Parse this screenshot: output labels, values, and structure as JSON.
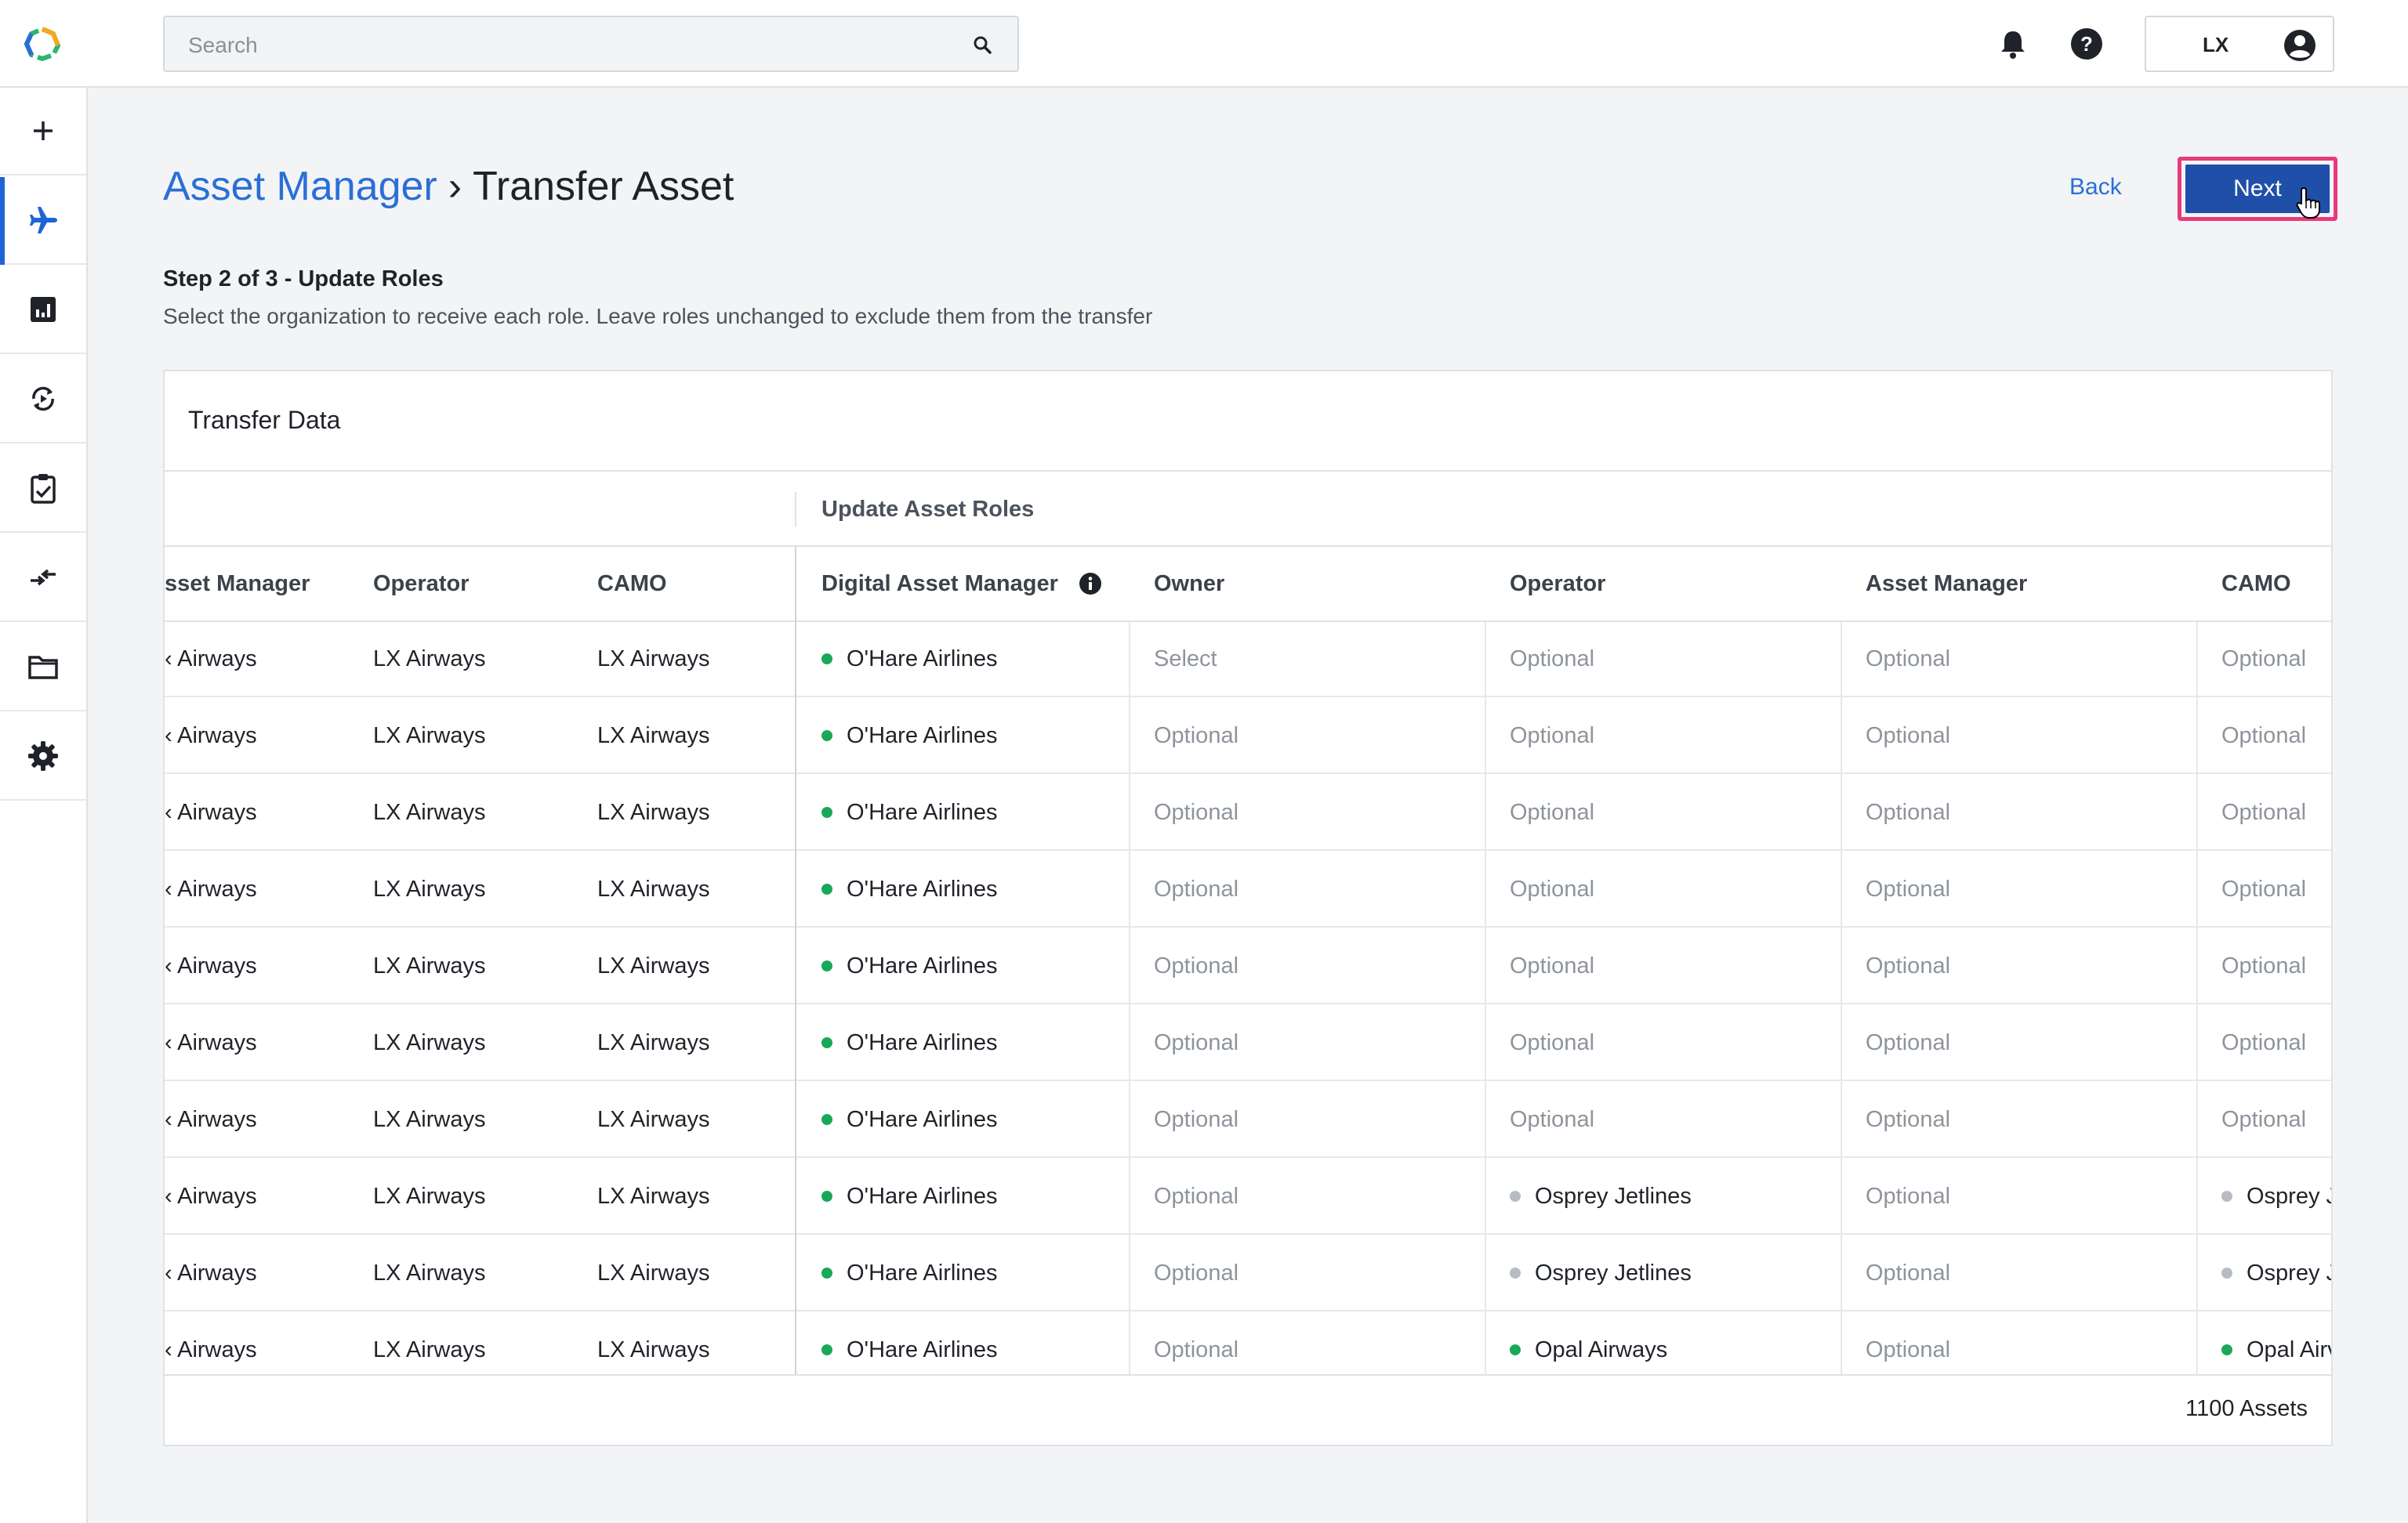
{
  "search": {
    "placeholder": "Search"
  },
  "user": {
    "initials": "LX"
  },
  "colors": {
    "accent": "#1f4fa8",
    "link": "#2a6fd6",
    "highlight": "#e83a7c",
    "status_green": "#18a858",
    "status_grey": "#b7bcc3"
  },
  "sidebar": {
    "items": [
      {
        "icon": "plus-icon"
      },
      {
        "icon": "airplane-icon",
        "active": true
      },
      {
        "icon": "chart-icon"
      },
      {
        "icon": "sync-icon"
      },
      {
        "icon": "clipboard-check-icon"
      },
      {
        "icon": "transfer-icon"
      },
      {
        "icon": "folder-icon"
      },
      {
        "icon": "gear-icon"
      }
    ]
  },
  "breadcrumb": {
    "parent": "Asset Manager",
    "separator": "›",
    "current": "Transfer Asset"
  },
  "actions": {
    "back": "Back",
    "next": "Next"
  },
  "step": {
    "title": "Step 2 of 3 - Update Roles",
    "description": "Select the organization to receive each role. Leave roles unchanged to exclude them from the transfer"
  },
  "card": {
    "title": "Transfer Data",
    "group_label": "Update Asset Roles",
    "footer": "1100 Assets"
  },
  "table": {
    "columns": [
      "sset Manager",
      "Operator",
      "CAMO",
      "Digital Asset Manager",
      "Owner",
      "Operator",
      "Asset Manager",
      "CAMO"
    ],
    "rows": [
      {
        "asset_manager": "‹ Airways",
        "operator": "LX Airways",
        "camo": "LX Airways",
        "dam": "O'Hare Airlines",
        "owner": "Select",
        "new_operator": "Optional",
        "new_asset_manager": "Optional",
        "new_camo": "Optional"
      },
      {
        "asset_manager": "‹ Airways",
        "operator": "LX Airways",
        "camo": "LX Airways",
        "dam": "O'Hare Airlines",
        "owner": "Optional",
        "new_operator": "Optional",
        "new_asset_manager": "Optional",
        "new_camo": "Optional"
      },
      {
        "asset_manager": "‹ Airways",
        "operator": "LX Airways",
        "camo": "LX Airways",
        "dam": "O'Hare Airlines",
        "owner": "Optional",
        "new_operator": "Optional",
        "new_asset_manager": "Optional",
        "new_camo": "Optional"
      },
      {
        "asset_manager": "‹ Airways",
        "operator": "LX Airways",
        "camo": "LX Airways",
        "dam": "O'Hare Airlines",
        "owner": "Optional",
        "new_operator": "Optional",
        "new_asset_manager": "Optional",
        "new_camo": "Optional"
      },
      {
        "asset_manager": "‹ Airways",
        "operator": "LX Airways",
        "camo": "LX Airways",
        "dam": "O'Hare Airlines",
        "owner": "Optional",
        "new_operator": "Optional",
        "new_asset_manager": "Optional",
        "new_camo": "Optional"
      },
      {
        "asset_manager": "‹ Airways",
        "operator": "LX Airways",
        "camo": "LX Airways",
        "dam": "O'Hare Airlines",
        "owner": "Optional",
        "new_operator": "Optional",
        "new_asset_manager": "Optional",
        "new_camo": "Optional"
      },
      {
        "asset_manager": "‹ Airways",
        "operator": "LX Airways",
        "camo": "LX Airways",
        "dam": "O'Hare Airlines",
        "owner": "Optional",
        "new_operator": "Optional",
        "new_asset_manager": "Optional",
        "new_camo": "Optional"
      },
      {
        "asset_manager": "‹ Airways",
        "operator": "LX Airways",
        "camo": "LX Airways",
        "dam": "O'Hare Airlines",
        "owner": "Optional",
        "new_operator": "Osprey Jetlines",
        "new_operator_status": "grey",
        "new_asset_manager": "Optional",
        "new_camo": "Osprey J",
        "new_camo_status": "grey"
      },
      {
        "asset_manager": "‹ Airways",
        "operator": "LX Airways",
        "camo": "LX Airways",
        "dam": "O'Hare Airlines",
        "owner": "Optional",
        "new_operator": "Osprey Jetlines",
        "new_operator_status": "grey",
        "new_asset_manager": "Optional",
        "new_camo": "Osprey J",
        "new_camo_status": "grey"
      },
      {
        "asset_manager": "‹ Airways",
        "operator": "LX Airways",
        "camo": "LX Airways",
        "dam": "O'Hare Airlines",
        "owner": "Optional",
        "new_operator": "Opal Airways",
        "new_operator_status": "green",
        "new_asset_manager": "Optional",
        "new_camo": "Opal Airv",
        "new_camo_status": "green"
      }
    ]
  }
}
